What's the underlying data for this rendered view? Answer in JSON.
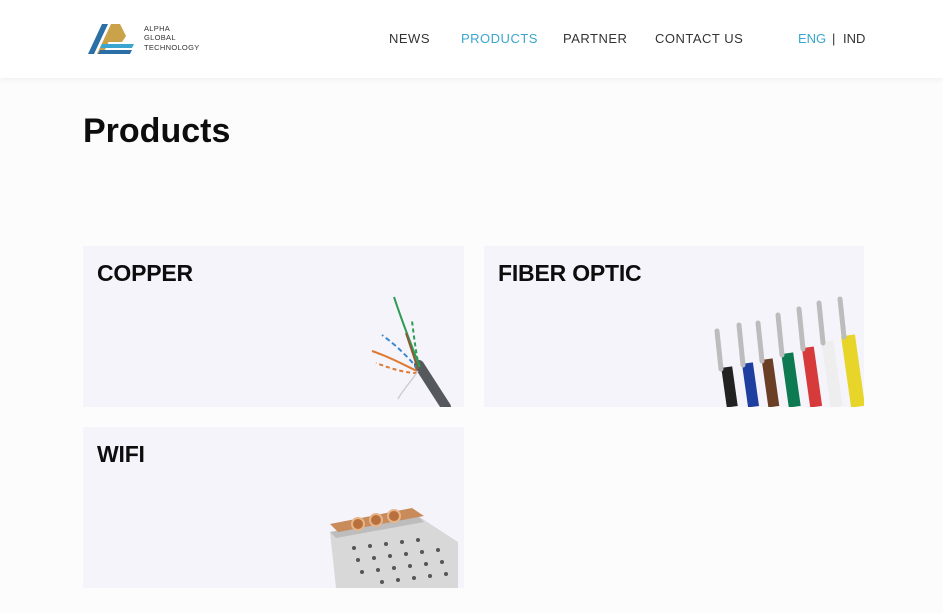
{
  "brand": {
    "line1": "ALPHA",
    "line2": "GLOBAL",
    "line3": "TECHNOLOGY"
  },
  "nav": {
    "items": [
      "NEWS",
      "PRODUCTS",
      "PARTNER",
      "CONTACT US"
    ],
    "active": "PRODUCTS"
  },
  "language": {
    "options": [
      "ENG",
      "IND"
    ],
    "separator": "|",
    "active": "ENG"
  },
  "page": {
    "title": "Products"
  },
  "products": [
    {
      "title": "COPPER",
      "image": "copper-cable-image"
    },
    {
      "title": "FIBER OPTIC",
      "image": "colored-wires-image"
    },
    {
      "title": "WIFI",
      "image": "wifi-module-image"
    }
  ],
  "colors": {
    "accent": "#3aa6cf",
    "card_bg": "#f5f4fb",
    "logo_gold": "#c9a24a",
    "logo_blue": "#2b6fa6"
  }
}
